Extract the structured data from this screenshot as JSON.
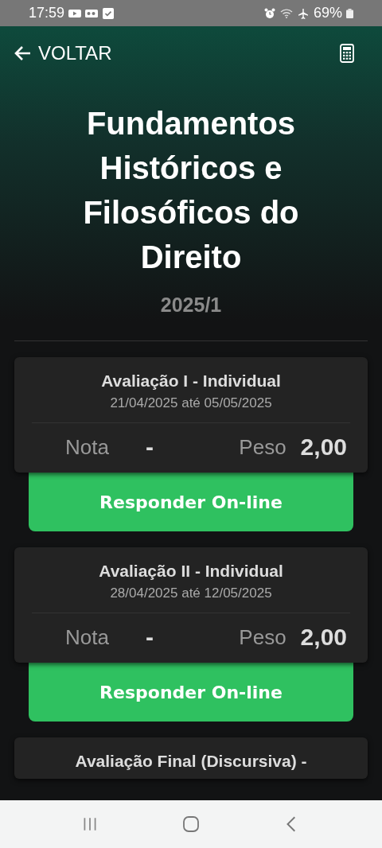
{
  "status_bar": {
    "time": "17:59",
    "battery": "69%"
  },
  "header": {
    "back_label": "VOLTAR"
  },
  "course": {
    "title": "Fundamentos Históricos e Filosóficos do Direito",
    "period": "2025/1"
  },
  "assessments": [
    {
      "title": "Avaliação I - Individual",
      "dates": "21/04/2025 até 05/05/2025",
      "grade_label": "Nota",
      "grade": "-",
      "weight_label": "Peso",
      "weight": "2,00",
      "action": "Responder On-line"
    },
    {
      "title": "Avaliação II - Individual",
      "dates": "28/04/2025 até 12/05/2025",
      "grade_label": "Nota",
      "grade": "-",
      "weight_label": "Peso",
      "weight": "2,00",
      "action": "Responder On-line"
    },
    {
      "title": "Avaliação Final (Discursiva) -"
    }
  ]
}
